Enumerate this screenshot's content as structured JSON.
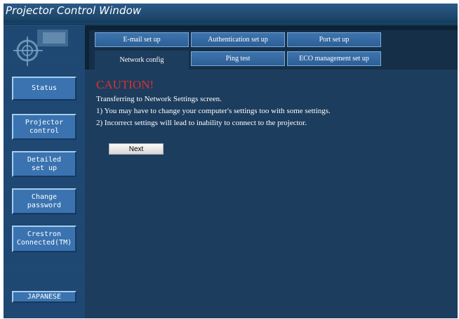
{
  "window": {
    "title": "Projector Control Window"
  },
  "sidebar": {
    "items": [
      {
        "label": "Status"
      },
      {
        "label": "Projector\ncontrol"
      },
      {
        "label": "Detailed\nset up"
      },
      {
        "label": "Change\npassword"
      },
      {
        "label": "Crestron\nConnected(TM)"
      }
    ],
    "language_button": "JAPANESE"
  },
  "tabs": {
    "row1": [
      "E-mail set up",
      "Authentication set up",
      "Port set up"
    ],
    "row2": [
      "Network config",
      "Ping test",
      "ECO management set up"
    ],
    "active": "Network config"
  },
  "content": {
    "heading": "CAUTION!",
    "intro": "Transferring to Network Settings screen.",
    "items": [
      "1)  You may have to change your computer's settings too with some settings.",
      "2)  Incorrect settings will lead to inability to connect to the projector."
    ],
    "next_button": "Next"
  },
  "colors": {
    "title_bar": "#1d4468",
    "background": "#0d2236",
    "content_panel": "#1c3d5e",
    "button_blue": "#3a73b0",
    "caution_red": "#e0312e"
  },
  "icons": {
    "logo": "crosshair-logo-icon"
  }
}
